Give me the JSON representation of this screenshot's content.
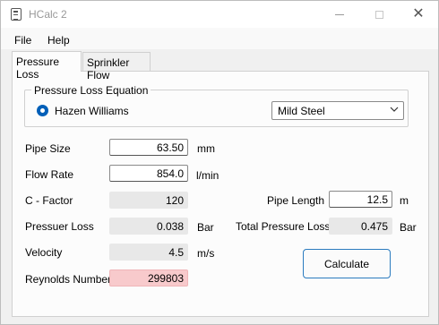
{
  "window": {
    "title": "HCalc 2"
  },
  "menu": {
    "file": "File",
    "help": "Help"
  },
  "tabs": [
    {
      "label": "Pressure Loss",
      "active": true
    },
    {
      "label": "Sprinkler Flow",
      "active": false
    }
  ],
  "equation": {
    "group_title": "Pressure Loss Equation",
    "radio_label": "Hazen Williams",
    "material": "Mild Steel"
  },
  "fields": {
    "pipe_size": {
      "label": "Pipe Size",
      "value": "63.50",
      "unit": "mm"
    },
    "flow_rate": {
      "label": "Flow Rate",
      "value": "854.0",
      "unit": "l/min"
    },
    "c_factor": {
      "label": "C - Factor",
      "value": "120"
    },
    "pressure_loss": {
      "label": "Pressuer Loss",
      "value": "0.038",
      "unit": "Bar"
    },
    "velocity": {
      "label": "Velocity",
      "value": "4.5",
      "unit": "m/s"
    },
    "reynolds": {
      "label": "Reynolds Number",
      "value": "299803"
    },
    "pipe_length": {
      "label": "Pipe Length",
      "value": "12.5",
      "unit": "m"
    },
    "total_pressure_loss": {
      "label": "Total Pressure Loss",
      "value": "0.475",
      "unit": "Bar"
    }
  },
  "buttons": {
    "calculate": "Calculate"
  },
  "colors": {
    "accent": "#005fb8",
    "warning_field": "#f8cacc",
    "readonly_field": "#e8e8e8"
  }
}
